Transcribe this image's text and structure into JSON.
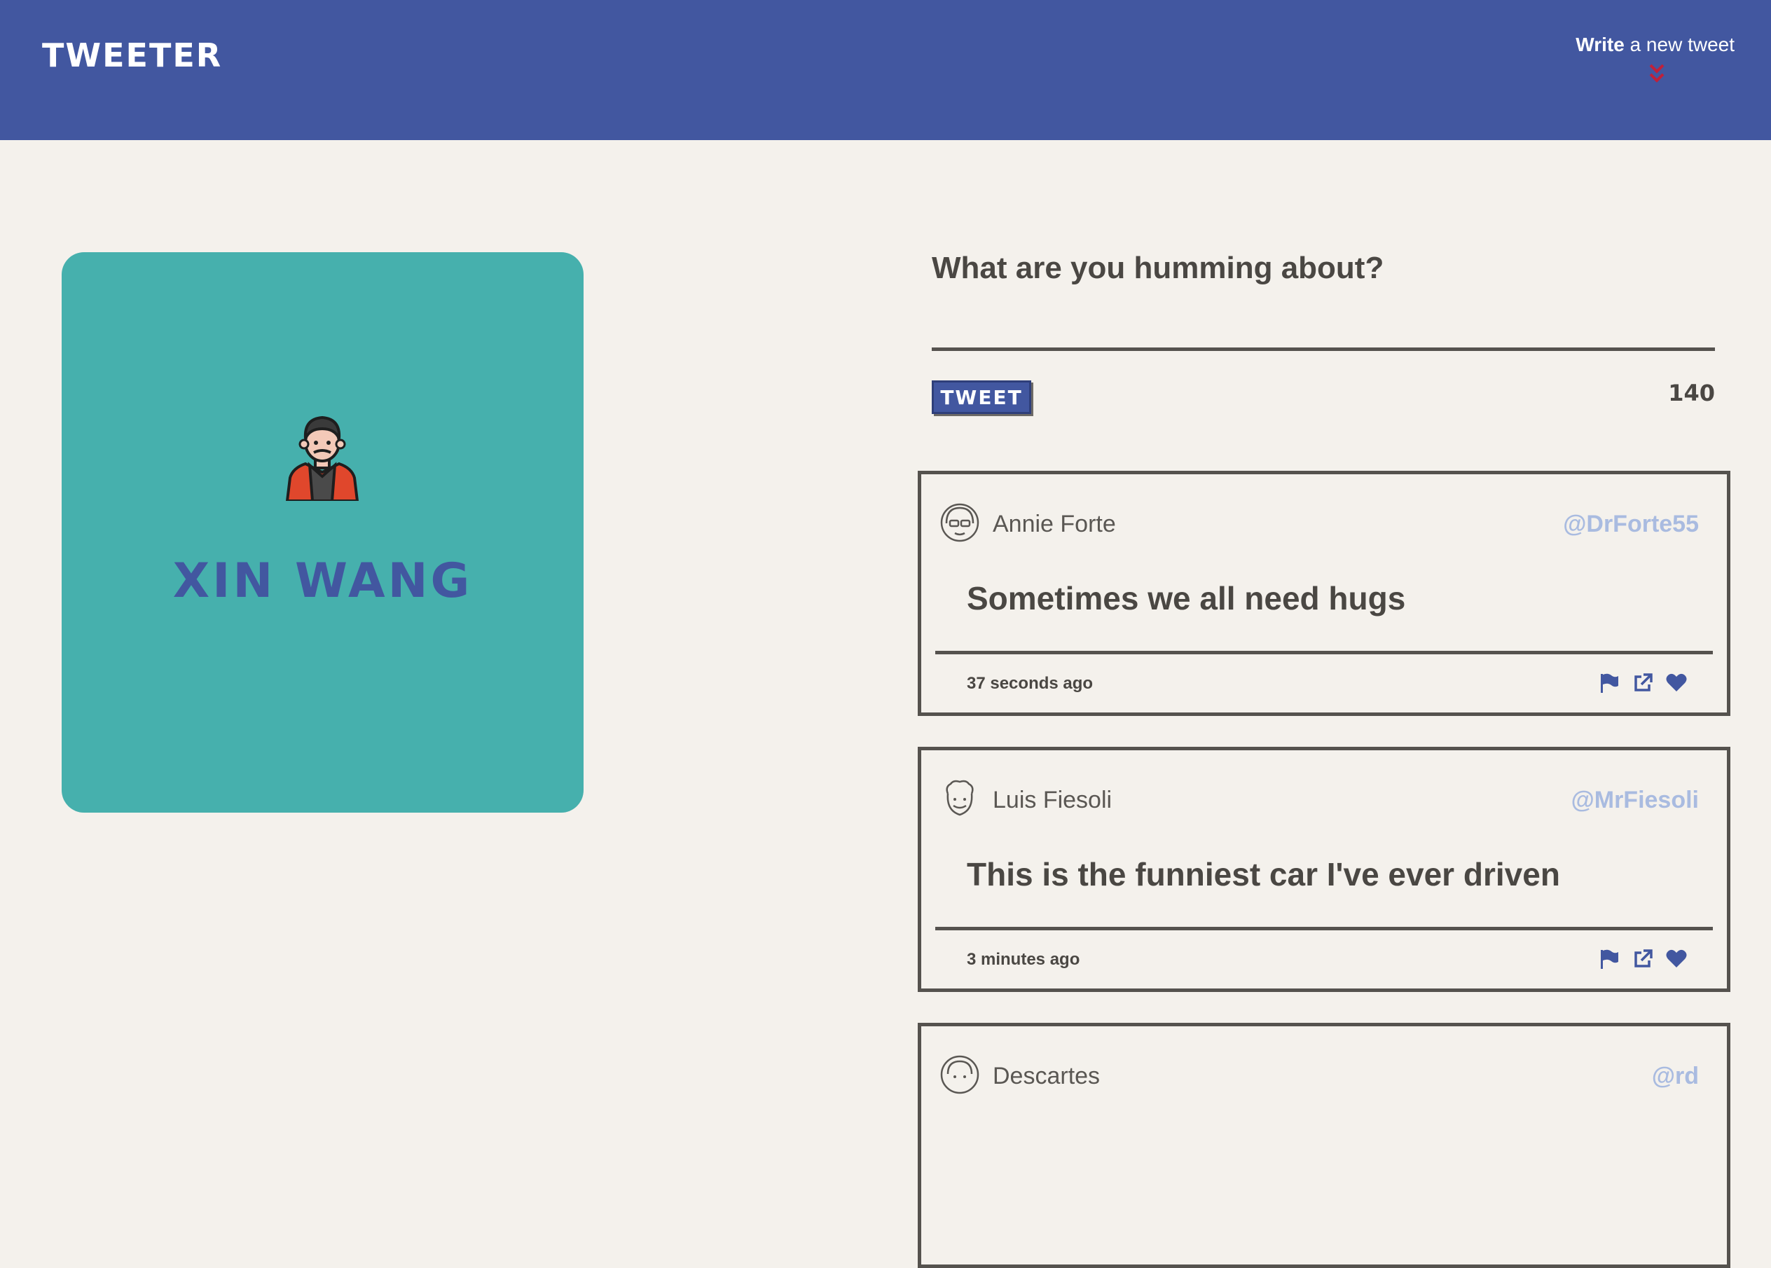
{
  "header": {
    "logo": "TWEETER",
    "write_bold": "Write",
    "write_rest": " a new tweet",
    "chevron_icon": "double-chevron-down-icon",
    "chevron_color": "#c0203a"
  },
  "profile": {
    "name": "XIN WANG",
    "avatar_icon": "man-avatar-icon"
  },
  "compose": {
    "label": "What are you humming about?",
    "value": "",
    "button": "TWEET",
    "counter": "140"
  },
  "tweets": [
    {
      "name": "Annie Forte",
      "handle": "@DrForte55",
      "text": "Sometimes we all need hugs",
      "time": "37 seconds ago",
      "avatar_icon": "woman-sunglasses-avatar-icon"
    },
    {
      "name": "Luis Fiesoli",
      "handle": "@MrFiesoli",
      "text": "This is the funniest car I've ever driven",
      "time": "3 minutes ago",
      "avatar_icon": "curly-man-avatar-icon"
    },
    {
      "name": "Descartes",
      "handle": "@rd",
      "text": "",
      "time": "",
      "avatar_icon": "woman-avatar-icon"
    }
  ],
  "colors": {
    "header": "#4257a0",
    "background": "#f4f1ec",
    "card": "#46b0ad",
    "accent": "#4257a0",
    "handle": "#a9bbe0"
  }
}
